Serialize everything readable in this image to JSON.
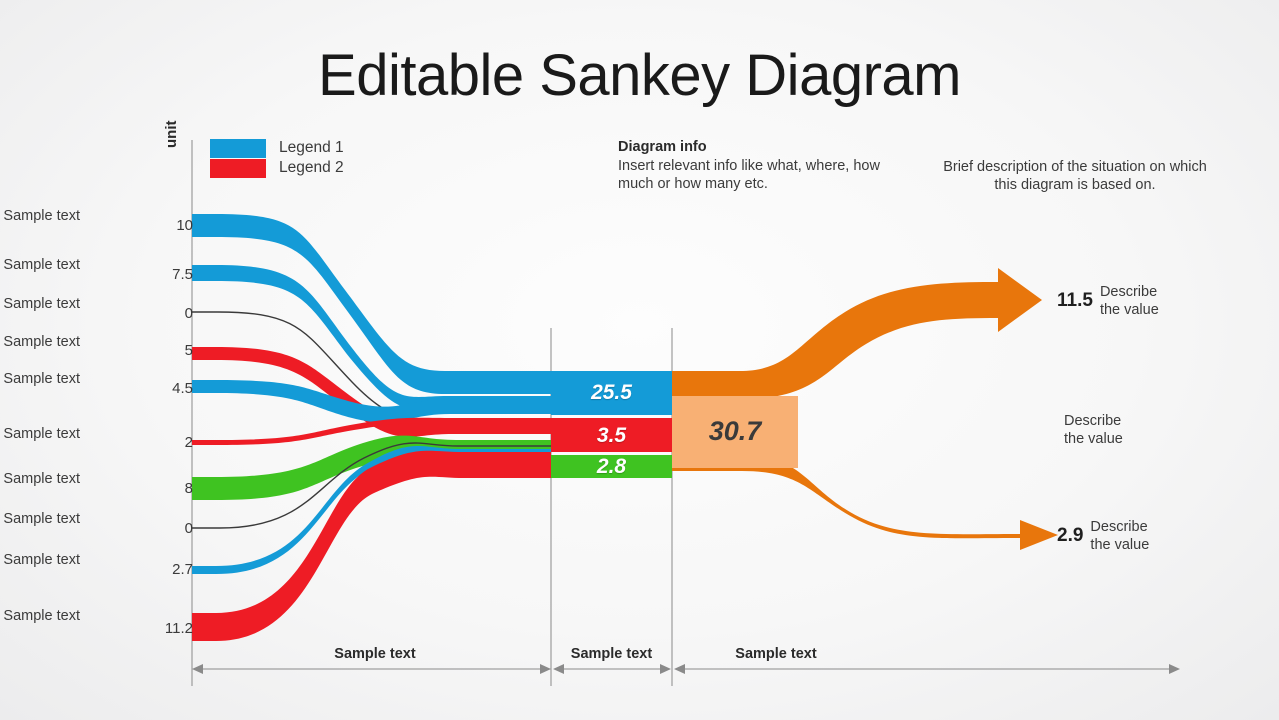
{
  "title": "Editable Sankey Diagram",
  "axis": {
    "unit_label": "unit"
  },
  "legend": {
    "items": [
      {
        "label": "Legend 1",
        "color": "#149BD7"
      },
      {
        "label": "Legend 2",
        "color": "#EE1C25"
      }
    ]
  },
  "info": {
    "heading": "Diagram info",
    "body": "Insert relevant info like what, where, how much or how many etc."
  },
  "brief": "Brief description of the situation on which this diagram is based on.",
  "sources": [
    {
      "label": "Sample\ntext",
      "value": "10",
      "color": "#149BD7"
    },
    {
      "label": "Sample\ntext",
      "value": "7.5",
      "color": "#149BD7"
    },
    {
      "label": "Sample\ntext",
      "value": "0",
      "color": "#3A3A3A"
    },
    {
      "label": "Sample\ntext",
      "value": "5",
      "color": "#EE1C25"
    },
    {
      "label": "Sample\ntext",
      "value": "4.5",
      "color": "#149BD7"
    },
    {
      "label": "Sample\ntext",
      "value": "2",
      "color": "#EE1C25"
    },
    {
      "label": "Sample\ntext",
      "value": "8",
      "color": "#3FC321"
    },
    {
      "label": "Sample\ntext",
      "value": "0",
      "color": "#3A3A3A"
    },
    {
      "label": "Sample\ntext",
      "value": "2.7",
      "color": "#149BD7"
    },
    {
      "label": "Sample\ntext",
      "value": "11.2",
      "color": "#EE1C25"
    }
  ],
  "source_labels": {
    "l0": "Sample text",
    "l1": "Sample text",
    "l2": "Sample text",
    "l3": "Sample text",
    "l4": "Sample text",
    "l5": "Sample text",
    "l6": "Sample text",
    "l7": "Sample text",
    "l8": "Sample text",
    "l9": "Sample text"
  },
  "nodes": [
    {
      "value": "25.5",
      "color": "#149BD7"
    },
    {
      "value": "3.5",
      "color": "#EE1C25"
    },
    {
      "value": "2.8",
      "color": "#3FC321"
    }
  ],
  "pool": {
    "value": "30.7",
    "color": "#F8B074"
  },
  "outputs": [
    {
      "value": "11.5",
      "text": "Describe\nthe value",
      "line1": "Describe",
      "line2": "the value"
    },
    {
      "value": "",
      "text": "Describe\nthe value",
      "line1": "Describe",
      "line2": "the value"
    },
    {
      "value": "2.9",
      "text": "Describe\nthe value",
      "line1": "Describe",
      "line2": "the value"
    }
  ],
  "sections": [
    {
      "label": "Sample text"
    },
    {
      "label": "Sample text"
    },
    {
      "label": "Sample text"
    }
  ],
  "chart_data": {
    "type": "sankey",
    "title": "Editable Sankey Diagram",
    "unit": "unit",
    "legend": [
      "Legend 1",
      "Legend 2"
    ],
    "stages": [
      "Sample text",
      "Sample text",
      "Sample text"
    ],
    "source_values": [
      10,
      7.5,
      0,
      5,
      4.5,
      2,
      8,
      0,
      2.7,
      11.2
    ],
    "source_colors": [
      "#149BD7",
      "#149BD7",
      "#3A3A3A",
      "#EE1C25",
      "#149BD7",
      "#EE1C25",
      "#3FC321",
      "#3A3A3A",
      "#149BD7",
      "#EE1C25"
    ],
    "mid_nodes": [
      {
        "value": 25.5,
        "color": "#149BD7"
      },
      {
        "value": 3.5,
        "color": "#EE1C25"
      },
      {
        "value": 2.8,
        "color": "#3FC321"
      }
    ],
    "pool_total": 30.7,
    "outputs": [
      11.5,
      2.9
    ],
    "grid": false,
    "legend_position": "top-left"
  },
  "colors": {
    "blue": "#149BD7",
    "red": "#EE1C25",
    "green": "#3FC321",
    "black": "#3A3A3A",
    "orange": "#E8760C",
    "orange_light": "#F8B074",
    "axis": "#8A8A8A"
  }
}
